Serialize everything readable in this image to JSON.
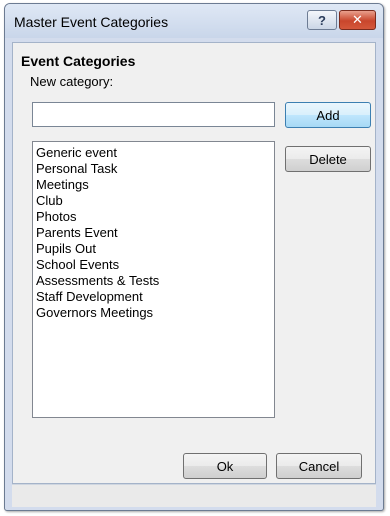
{
  "window": {
    "title": "Master Event Categories",
    "help_label": "?",
    "close_label": "✕"
  },
  "group": {
    "title": "Event Categories"
  },
  "new_category": {
    "label": "New category:",
    "value": ""
  },
  "buttons": {
    "add": "Add",
    "delete": "Delete",
    "ok": "Ok",
    "cancel": "Cancel"
  },
  "categories": [
    "Generic event",
    "Personal Task",
    "Meetings",
    "Club",
    "Photos",
    "Parents Event",
    "Pupils Out",
    "School Events",
    "Assessments & Tests",
    "Staff Development",
    "Governors Meetings"
  ],
  "colors": {
    "titlebar": "#c9d6ea",
    "client": "#f0f0f0",
    "close_button": "#c9462c",
    "default_button_border": "#3c7fb1"
  }
}
